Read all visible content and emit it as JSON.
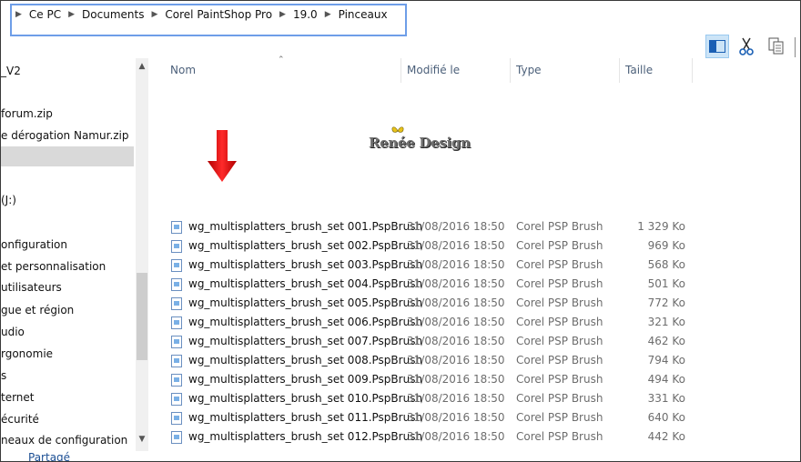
{
  "breadcrumb": [
    "Ce PC",
    "Documents",
    "Corel PaintShop Pro",
    "19.0",
    "Pinceaux"
  ],
  "ribbon": {
    "icons": [
      "preview-pane-icon",
      "scissors-icon",
      "copy-icon"
    ]
  },
  "nav": {
    "items": [
      "_V2",
      "forum.zip",
      "e dérogation Namur.zip",
      "",
      "(J:)",
      "onfiguration",
      "et personnalisation",
      "utilisateurs",
      "gue et région",
      "udio",
      "rgonomie",
      "s",
      "ternet",
      "écurité",
      "neaux de configuration",
      "Partagé"
    ]
  },
  "columns": {
    "name": "Nom",
    "modified": "Modifié le",
    "type": "Type",
    "size": "Taille"
  },
  "watermark": {
    "text": "Renée Design"
  },
  "files": [
    {
      "name": "wg_multisplatters_brush_set 001.PspBrush",
      "modified": "31/08/2016 18:50",
      "type": "Corel PSP Brush",
      "size": "1 329 Ko"
    },
    {
      "name": "wg_multisplatters_brush_set 002.PspBrush",
      "modified": "31/08/2016 18:50",
      "type": "Corel PSP Brush",
      "size": "969 Ko"
    },
    {
      "name": "wg_multisplatters_brush_set 003.PspBrush",
      "modified": "31/08/2016 18:50",
      "type": "Corel PSP Brush",
      "size": "568 Ko"
    },
    {
      "name": "wg_multisplatters_brush_set 004.PspBrush",
      "modified": "31/08/2016 18:50",
      "type": "Corel PSP Brush",
      "size": "501 Ko"
    },
    {
      "name": "wg_multisplatters_brush_set 005.PspBrush",
      "modified": "31/08/2016 18:50",
      "type": "Corel PSP Brush",
      "size": "772 Ko"
    },
    {
      "name": "wg_multisplatters_brush_set 006.PspBrush",
      "modified": "31/08/2016 18:50",
      "type": "Corel PSP Brush",
      "size": "321 Ko"
    },
    {
      "name": "wg_multisplatters_brush_set 007.PspBrush",
      "modified": "31/08/2016 18:50",
      "type": "Corel PSP Brush",
      "size": "462 Ko"
    },
    {
      "name": "wg_multisplatters_brush_set 008.PspBrush",
      "modified": "31/08/2016 18:50",
      "type": "Corel PSP Brush",
      "size": "794 Ko"
    },
    {
      "name": "wg_multisplatters_brush_set 009.PspBrush",
      "modified": "31/08/2016 18:50",
      "type": "Corel PSP Brush",
      "size": "494 Ko"
    },
    {
      "name": "wg_multisplatters_brush_set 010.PspBrush",
      "modified": "31/08/2016 18:50",
      "type": "Corel PSP Brush",
      "size": "331 Ko"
    },
    {
      "name": "wg_multisplatters_brush_set 011.PspBrush",
      "modified": "31/08/2016 18:50",
      "type": "Corel PSP Brush",
      "size": "640 Ko"
    },
    {
      "name": "wg_multisplatters_brush_set 012.PspBrush",
      "modified": "31/08/2016 18:50",
      "type": "Corel PSP Brush",
      "size": "442 Ko"
    }
  ],
  "colors": {
    "address_highlight": "#6e9ee8",
    "selected_nav": "#d9d9d9",
    "arrow_red": "#e81b1b",
    "header_text": "#4c607a"
  }
}
